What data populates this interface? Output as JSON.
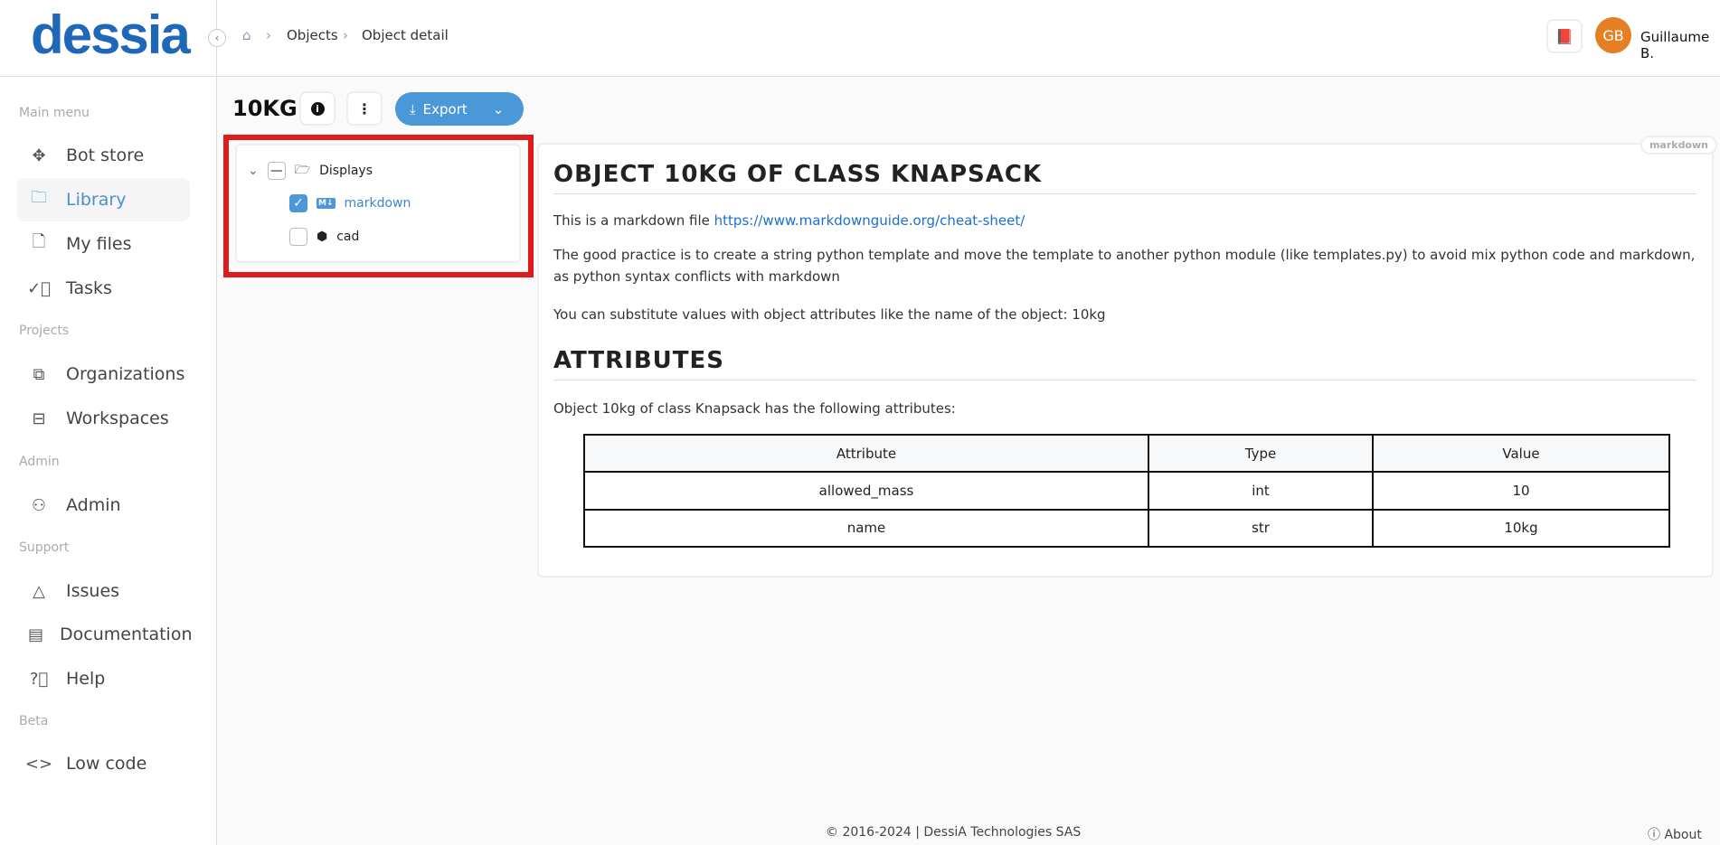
{
  "brand": {
    "logo": "dessia",
    "color": "#1f68b8"
  },
  "breadcrumb": {
    "items": [
      "Objects",
      "Object detail"
    ]
  },
  "user": {
    "initials": "GB",
    "name": "Guillaume B.",
    "avatar_color": "#e67e22"
  },
  "sidebar": {
    "sections": [
      {
        "label": "Main menu",
        "items": [
          {
            "label": "Bot store",
            "icon": "bot-store-icon"
          },
          {
            "label": "Library",
            "icon": "folder-icon",
            "active": true
          },
          {
            "label": "My files",
            "icon": "file-icon"
          },
          {
            "label": "Tasks",
            "icon": "check-circle-icon"
          }
        ]
      },
      {
        "label": "Projects",
        "items": [
          {
            "label": "Organizations",
            "icon": "org-chart-icon"
          },
          {
            "label": "Workspaces",
            "icon": "briefcase-icon"
          }
        ]
      },
      {
        "label": "Admin",
        "items": [
          {
            "label": "Admin",
            "icon": "user-gear-icon"
          }
        ]
      },
      {
        "label": "Support",
        "items": [
          {
            "label": "Issues",
            "icon": "warning-icon"
          },
          {
            "label": "Documentation",
            "icon": "document-icon"
          },
          {
            "label": "Help",
            "icon": "help-icon"
          }
        ]
      },
      {
        "label": "Beta",
        "items": [
          {
            "label": "Low code",
            "icon": "code-icon"
          }
        ]
      }
    ]
  },
  "toolbar": {
    "title": "10KG",
    "export_label": "Export",
    "accent": "#4a98d8"
  },
  "tree": {
    "root": "Displays",
    "children": [
      {
        "label": "markdown",
        "checked": true
      },
      {
        "label": "cad",
        "checked": false
      }
    ]
  },
  "content": {
    "badge": "markdown",
    "h1": "OBJECT 10KG OF CLASS KNAPSACK",
    "p1_text": "This is a markdown file ",
    "p1_link": "https://www.markdownguide.org/cheat-sheet/",
    "p2": "The good practice is to create a string python template and move the template to another python module (like templates.py) to avoid mix python code and markdown, as python syntax conflicts with markdown",
    "p3": "You can substitute values with object attributes like the name of the object: 10kg",
    "h2": "ATTRIBUTES",
    "p4": "Object 10kg of class Knapsack has the following attributes:",
    "table": {
      "headers": [
        "Attribute",
        "Type",
        "Value"
      ],
      "rows": [
        [
          "allowed_mass",
          "int",
          "10"
        ],
        [
          "name",
          "str",
          "10kg"
        ]
      ]
    }
  },
  "footer": {
    "copyright": "© 2016-2024 | DessiA Technologies SAS",
    "about": "About"
  }
}
